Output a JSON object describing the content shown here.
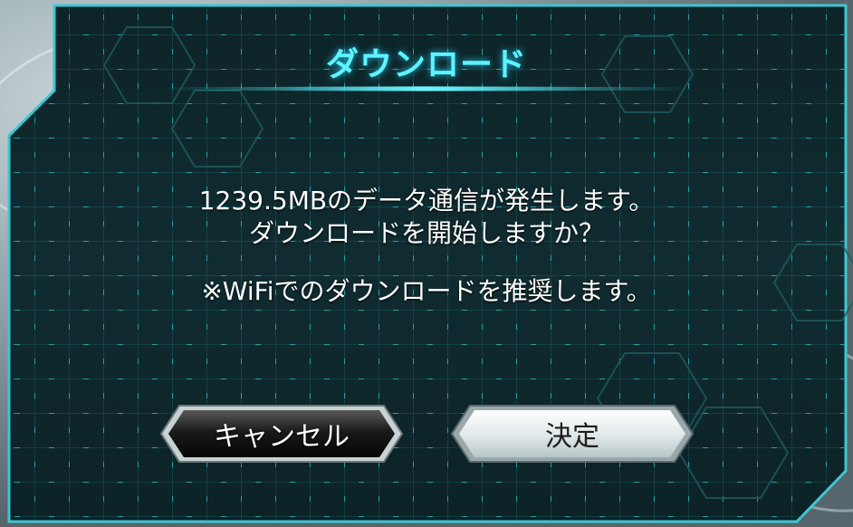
{
  "dialog": {
    "title": "ダウンロード",
    "message_line1": "1239.5MBのデータ通信が発生します。",
    "message_line2": "ダウンロードを開始しますか？",
    "note": "※WiFiでのダウンロードを推奨します。"
  },
  "buttons": {
    "cancel_label": "キャンセル",
    "confirm_label": "決定"
  },
  "colors": {
    "title": "#5ff3ff",
    "panel": "#0f2a2e",
    "border": "#2fd3e0",
    "grid": "#1f6f74"
  }
}
